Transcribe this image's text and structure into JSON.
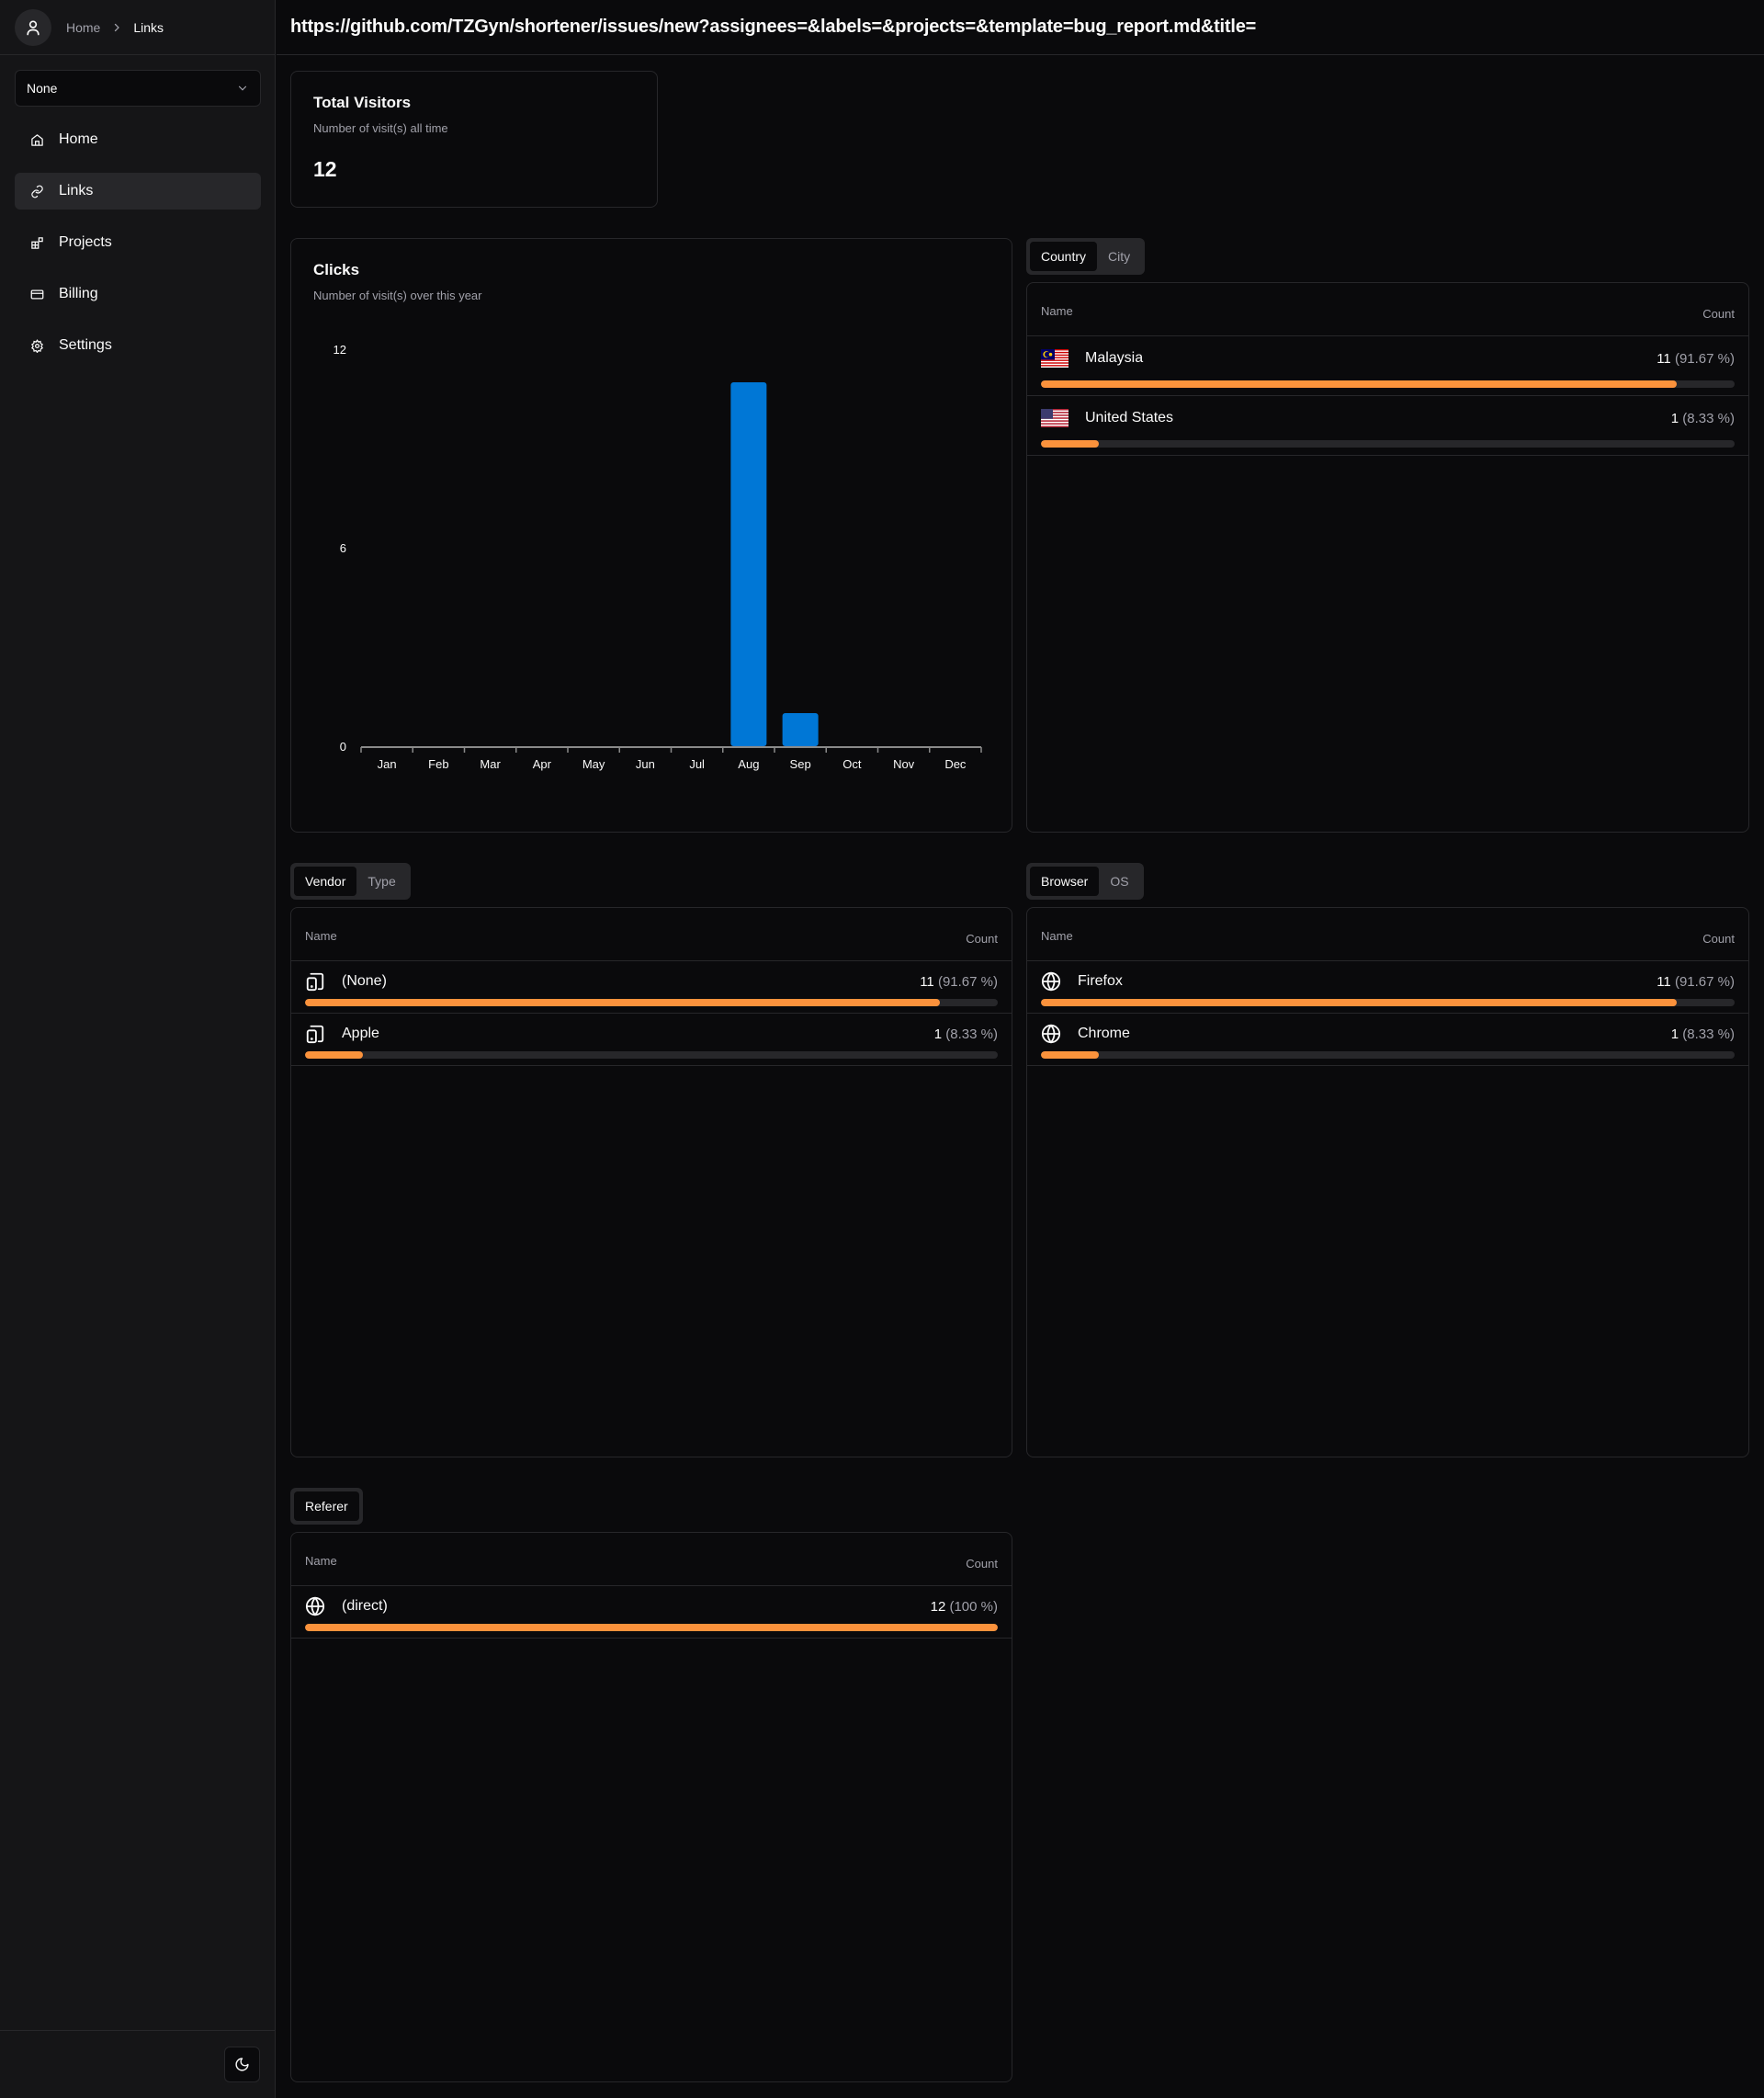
{
  "sidebar": {
    "breadcrumb": {
      "home": "Home",
      "current": "Links"
    },
    "project_select": {
      "value": "None"
    },
    "nav": [
      {
        "label": "Home",
        "icon": "home-icon"
      },
      {
        "label": "Links",
        "icon": "link-icon",
        "active": true
      },
      {
        "label": "Projects",
        "icon": "projects-icon"
      },
      {
        "label": "Billing",
        "icon": "credit-card-icon"
      },
      {
        "label": "Settings",
        "icon": "gear-icon"
      }
    ],
    "theme_toggle": {
      "icon": "moon-icon"
    }
  },
  "header": {
    "title": "https://github.com/TZGyn/shortener/issues/new?assignees=&labels=&projects=&template=bug_report.md&title="
  },
  "visitors": {
    "title": "Total Visitors",
    "subtitle": "Number of visit(s) all time",
    "value": "12"
  },
  "clicks": {
    "title": "Clicks",
    "subtitle": "Number of visit(s) over this year"
  },
  "chart_data": {
    "type": "bar",
    "title": "Clicks",
    "subtitle": "Number of visit(s) over this year",
    "categories": [
      "Jan",
      "Feb",
      "Mar",
      "Apr",
      "May",
      "Jun",
      "Jul",
      "Aug",
      "Sep",
      "Oct",
      "Nov",
      "Dec"
    ],
    "values": [
      0,
      0,
      0,
      0,
      0,
      0,
      0,
      11,
      1,
      0,
      0,
      0
    ],
    "xlabel": "",
    "ylabel": "",
    "ylim": [
      0,
      12
    ],
    "yticks": [
      "0",
      "6",
      "12"
    ],
    "grid": false,
    "color": "#0077d6"
  },
  "colors": {
    "bar_fill": "#fb923c",
    "bar_track": "#27272a",
    "chart_bar": "#0077d6"
  },
  "geo": {
    "tabs": [
      "Country",
      "City"
    ],
    "active_tab": "Country",
    "header": {
      "name": "Name",
      "count": "Count"
    },
    "rows": [
      {
        "name": "Malaysia",
        "flag": "malaysia-flag-icon",
        "count": "11",
        "pct": "(91.67 %)",
        "fraction": 0.9167
      },
      {
        "name": "United States",
        "flag": "us-flag-icon",
        "count": "1",
        "pct": "(8.33 %)",
        "fraction": 0.0833
      }
    ]
  },
  "device": {
    "tabs": [
      "Vendor",
      "Type"
    ],
    "active_tab": "Vendor",
    "header": {
      "name": "Name",
      "count": "Count"
    },
    "rows": [
      {
        "name": "(None)",
        "icon": "tablet-smartphone-icon",
        "count": "11",
        "pct": "(91.67 %)",
        "fraction": 0.9167
      },
      {
        "name": "Apple",
        "icon": "tablet-smartphone-icon",
        "count": "1",
        "pct": "(8.33 %)",
        "fraction": 0.0833
      }
    ]
  },
  "browser": {
    "tabs": [
      "Browser",
      "OS"
    ],
    "active_tab": "Browser",
    "header": {
      "name": "Name",
      "count": "Count"
    },
    "rows": [
      {
        "name": "Firefox",
        "icon": "globe-icon",
        "count": "11",
        "pct": "(91.67 %)",
        "fraction": 0.9167
      },
      {
        "name": "Chrome",
        "icon": "globe-icon",
        "count": "1",
        "pct": "(8.33 %)",
        "fraction": 0.0833
      }
    ]
  },
  "referer": {
    "tabs": [
      "Referer"
    ],
    "active_tab": "Referer",
    "header": {
      "name": "Name",
      "count": "Count"
    },
    "rows": [
      {
        "name": "(direct)",
        "icon": "globe-icon",
        "count": "12",
        "pct": "(100 %)",
        "fraction": 1.0
      }
    ]
  }
}
